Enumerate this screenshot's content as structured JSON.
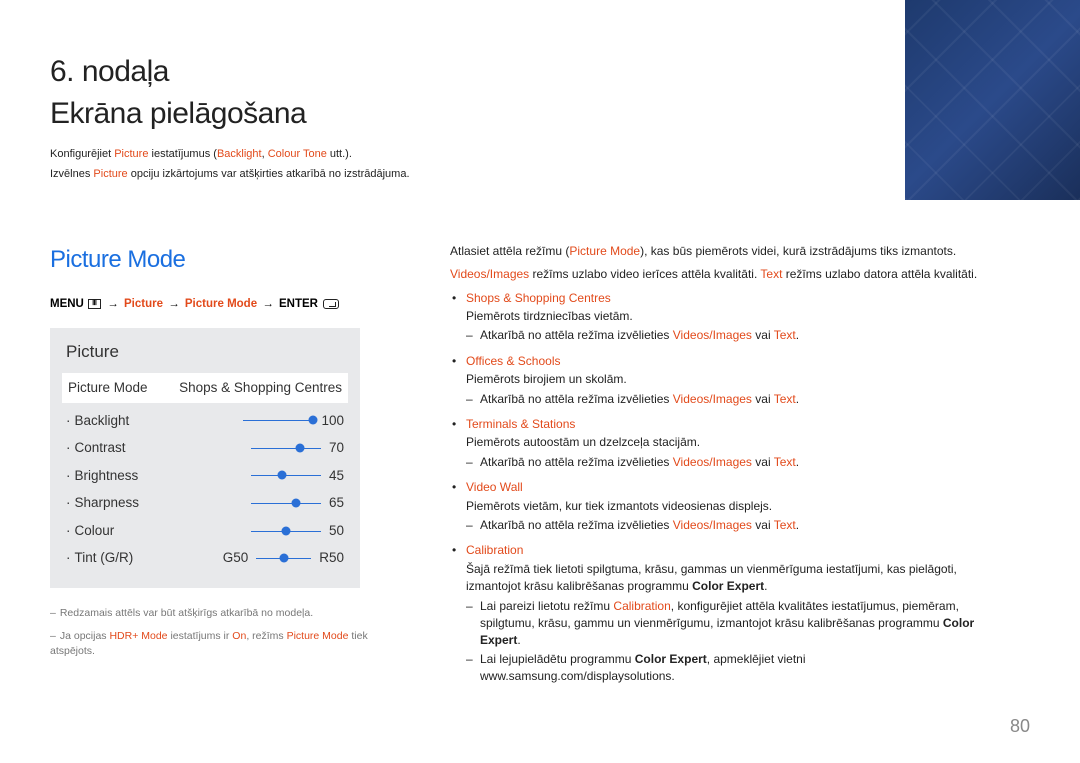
{
  "chapter": {
    "num": "6. nodaļa",
    "title": "Ekrāna pielāgošana"
  },
  "intro": {
    "line1_pre": "Konfigurējiet ",
    "line1_pic": "Picture",
    "line1_mid": " iestatījumus (",
    "line1_back": "Backlight",
    "line1_comma": ", ",
    "line1_ct": "Colour Tone",
    "line1_end": " utt.).",
    "line2_pre": "Izvēlnes ",
    "line2_pic": "Picture",
    "line2_end": " opciju izkārtojums var atšķirties atkarībā no izstrādājuma."
  },
  "section_title": "Picture Mode",
  "nav": {
    "menu": "MENU",
    "arrow": "→",
    "p1": "Picture",
    "p2": "Picture Mode",
    "enter": "ENTER"
  },
  "osd": {
    "title": "Picture",
    "pm_label": "Picture Mode",
    "pm_value": "Shops & Shopping Centres",
    "rows": [
      {
        "label": "Backlight",
        "value": "100",
        "pct": 100
      },
      {
        "label": "Contrast",
        "value": "70",
        "pct": 70
      },
      {
        "label": "Brightness",
        "value": "45",
        "pct": 45
      },
      {
        "label": "Sharpness",
        "value": "65",
        "pct": 65
      },
      {
        "label": "Colour",
        "value": "50",
        "pct": 50
      }
    ],
    "tint": {
      "label": "Tint (G/R)",
      "g": "G50",
      "r": "R50",
      "pct": 50
    }
  },
  "footnotes": {
    "f1": "Redzamais attēls var būt atšķirīgs atkarībā no modeļa.",
    "f2_pre": "Ja opcijas ",
    "f2_hdr": "HDR+ Mode",
    "f2_mid": " iestatījums ir ",
    "f2_on": "On",
    "f2_mid2": ", režīms ",
    "f2_pm": "Picture Mode",
    "f2_end": " tiek atspējots."
  },
  "desc": {
    "p1_pre": "Atlasiet attēla režīmu (",
    "p1_pm": "Picture Mode",
    "p1_end": "), kas būs piemērots videi, kurā izstrādājums tiks izmantots.",
    "p2_vi": "Videos/Images",
    "p2_mid": " režīms uzlabo video ierīces attēla kvalitāti. ",
    "p2_text": "Text",
    "p2_end": " režīms uzlabo datora attēla kvalitāti.",
    "items": [
      {
        "title": "Shops & Shopping Centres",
        "desc": "Piemērots tirdzniecības vietām.",
        "sub_pre": "Atkarībā no attēla režīma izvēlieties ",
        "sub_vi": "Videos/Images",
        "sub_or": " vai ",
        "sub_txt": "Text",
        "sub_end": "."
      },
      {
        "title": "Offices & Schools",
        "desc": "Piemērots birojiem un skolām.",
        "sub_pre": "Atkarībā no attēla režīma izvēlieties ",
        "sub_vi": "Videos/Images",
        "sub_or": " vai ",
        "sub_txt": "Text",
        "sub_end": "."
      },
      {
        "title": "Terminals & Stations",
        "desc": "Piemērots autoostām un dzelzceļa stacijām.",
        "sub_pre": "Atkarībā no attēla režīma izvēlieties ",
        "sub_vi": "Videos/Images",
        "sub_or": " vai ",
        "sub_txt": "Text",
        "sub_end": "."
      },
      {
        "title": "Video Wall",
        "desc": "Piemērots vietām, kur tiek izmantots videosienas displejs.",
        "sub_pre": "Atkarībā no attēla režīma izvēlieties ",
        "sub_vi": "Videos/Images",
        "sub_or": " vai ",
        "sub_txt": "Text",
        "sub_end": "."
      }
    ],
    "calibration": {
      "title": "Calibration",
      "desc_pre": "Šajā režīmā tiek lietoti spilgtuma, krāsu, gammas un vienmērīguma iestatījumi, kas pielāgoti, izmantojot krāsu kalibrēšanas programmu ",
      "desc_ce": "Color Expert",
      "desc_end": ".",
      "s1_pre": "Lai pareizi lietotu režīmu ",
      "s1_cal": "Calibration",
      "s1_mid": ", konfigurējiet attēla kvalitātes iestatījumus, piemēram, spilgtumu, krāsu, gammu un vienmērīgumu, izmantojot krāsu kalibrēšanas programmu ",
      "s1_ce": "Color Expert",
      "s1_end": ".",
      "s2_pre": "Lai lejupielādētu programmu ",
      "s2_ce": "Color Expert",
      "s2_end": ", apmeklējiet vietni www.samsung.com/displaysolutions."
    }
  },
  "page_number": "80"
}
